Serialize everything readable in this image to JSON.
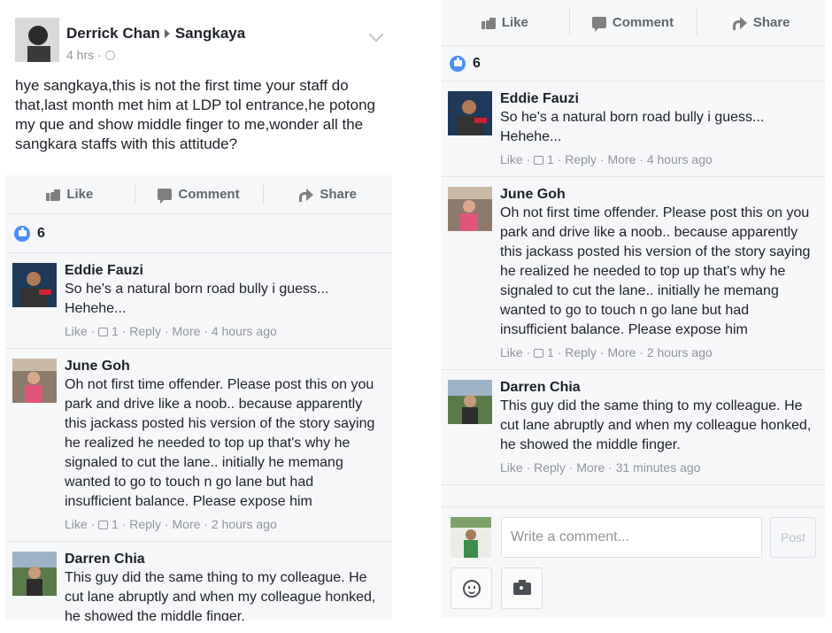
{
  "post": {
    "author": "Derrick Chan",
    "target": "Sangkaya",
    "time": "4 hrs ·",
    "text": "hye sangkaya,this is not the first time your staff do that,last month met him at LDP tol entrance,he potong my que and show middle finger to me,wonder all the sangkara staffs with this attitude?"
  },
  "actions": {
    "like": "Like",
    "comment": "Comment",
    "share": "Share"
  },
  "reactions": {
    "count": "6"
  },
  "comments": [
    {
      "name": "Eddie Fauzi",
      "text": "So he's a natural born road bully i guess... Hehehe...",
      "like": "Like ·",
      "likes": "1 ·",
      "reply": "Reply ·",
      "more": "More ·",
      "time": "4 hours ago"
    },
    {
      "name": "June Goh",
      "text": "Oh not first time offender. Please post this on you park and drive like a noob.. because apparently this jackass posted his version of the story saying he realized he needed to top up that's why he signaled to cut the lane.. initially he memang wanted to go to touch n go lane but had insufficient balance. Please expose him",
      "like": "Like ·",
      "likes": "1 ·",
      "reply": "Reply ·",
      "more": "More ·",
      "time": "2 hours ago"
    },
    {
      "name": "Darren Chia",
      "text": "This guy did the same thing to my colleague. He cut lane abruptly and when my colleague honked, he showed the middle finger.",
      "like": "Like ·",
      "reply": "Reply ·",
      "more": "More ·",
      "time": "31 minutes ago"
    }
  ],
  "composer": {
    "placeholder": "Write a comment...",
    "post_label": "Post"
  },
  "colors": {
    "accent": "#4a8ff5",
    "meta": "#90949c",
    "panel_bg": "#f6f7f9"
  }
}
